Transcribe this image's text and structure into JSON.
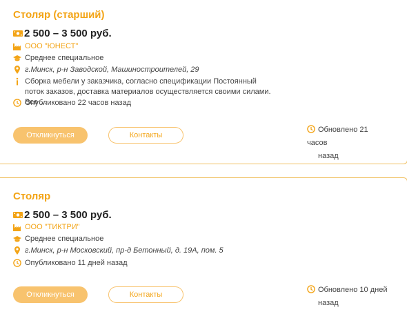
{
  "vacancies": [
    {
      "title": "Столяр (старший)",
      "salary": "2 500 – 3 500 руб.",
      "company": "ООО \"ЮНЕСТ\"",
      "education": "Среднее специальное",
      "address": "г.Минск, р-н Заводской, Машиностроителей, 29",
      "description": "Сборка мебели у заказчика, согласно спецификации Постоянный поток заказов, доставка материалов осуществляется своими силами. Все ...",
      "published": "Опубликовано 22 часов назад",
      "respond_label": "Откликнуться",
      "contacts_label": "Контакты",
      "updated_line1": "Обновлено 21 часов",
      "updated_line2": "назад"
    },
    {
      "title": "Столяр",
      "salary": "2 500 – 3 500 руб.",
      "company": "ООО \"ТИКТРИ\"",
      "education": "Среднее специальное",
      "address": "г.Минск, р-н Московский, пр-д Бетонный, д. 19А, пом. 5",
      "published": "Опубликовано 11 дней назад",
      "respond_label": "Откликнуться",
      "contacts_label": "Контакты",
      "updated_line1": "Обновлено 10 дней",
      "updated_line2": "назад"
    }
  ],
  "colors": {
    "accent": "#f3a416",
    "button": "#f8c36e",
    "border": "#f0c060"
  },
  "icons": {
    "salary": "money-icon",
    "company": "factory-icon",
    "education": "graduation-cap-icon",
    "address": "map-pin-icon",
    "description": "info-icon",
    "time": "clock-icon"
  }
}
